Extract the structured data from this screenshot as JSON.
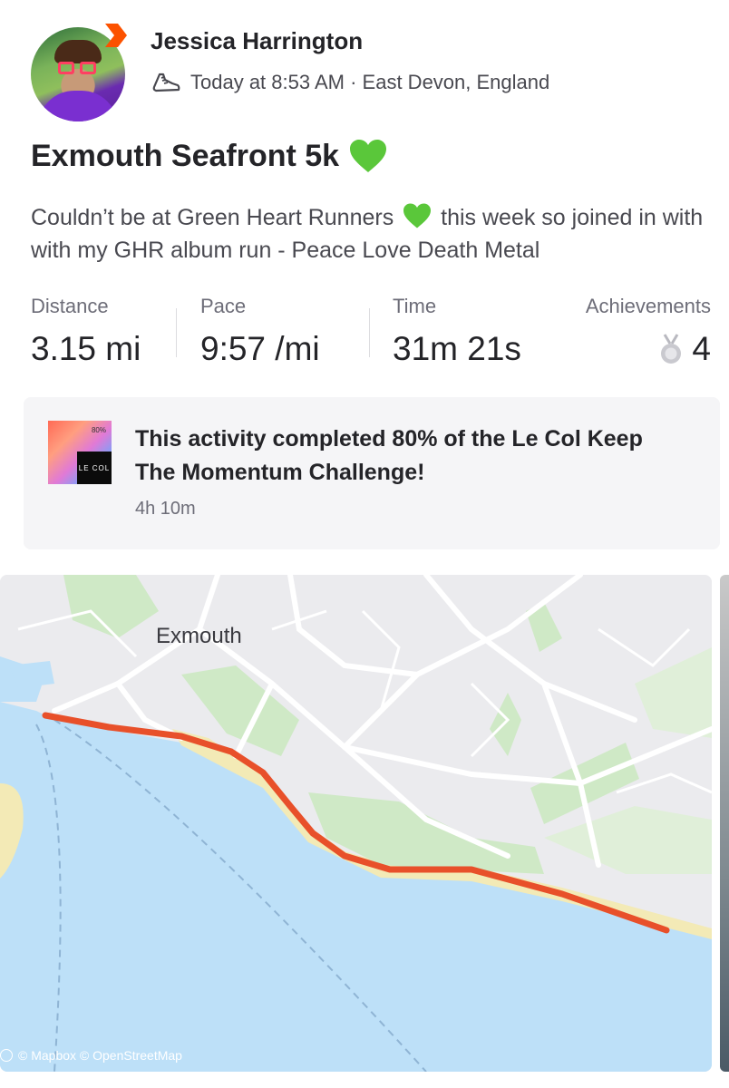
{
  "header": {
    "athlete_name": "Jessica Harrington",
    "meta": "Today at 8:53 AM · East Devon, England"
  },
  "activity": {
    "title": "Exmouth Seafront 5k",
    "description_part1": "Couldn’t be at Green Heart Runners",
    "description_part2": "this week so joined in with with my GHR album run - Peace Love Death Metal"
  },
  "stats": [
    {
      "label": "Distance",
      "value": "3.15 mi"
    },
    {
      "label": "Pace",
      "value": "9:57 /mi"
    },
    {
      "label": "Time",
      "value": "31m 21s"
    }
  ],
  "achievements": {
    "label": "Achievements",
    "value": "4"
  },
  "challenge": {
    "image_percent": "80%",
    "image_brand": "LE COL",
    "text": "This activity completed 80% of the Le Col Keep The Momentum Challenge!",
    "time_ago": "4h 10m",
    "progress_percent": 80
  },
  "map": {
    "town_label": "Exmouth",
    "credit": "© Mapbox © OpenStreetMap"
  },
  "colors": {
    "route": "#e8502a",
    "water": "#bde0f8",
    "park": "#c8e6c0",
    "sand": "#f3eab6",
    "heart": "#5ac73a",
    "brand_orange": "#fc5200"
  },
  "icons": [
    "strava-badge-icon",
    "running-shoe-icon",
    "green-heart-icon",
    "medal-icon"
  ]
}
